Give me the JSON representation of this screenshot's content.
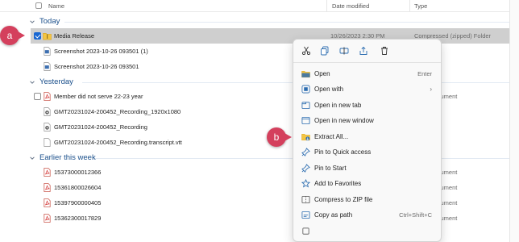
{
  "header": {
    "name": "Name",
    "date_modified": "Date modified",
    "type": "Type"
  },
  "groups": [
    {
      "label": "Today"
    },
    {
      "label": "Yesterday"
    },
    {
      "label": "Earlier this week"
    }
  ],
  "files": {
    "today": [
      {
        "name": "Media Release",
        "date": "10/26/2023 2:30 PM",
        "type": "Compressed (zipped) Folder",
        "icon": "zip-folder-icon",
        "selected": true
      },
      {
        "name": "Screenshot 2023-10-26 093501 (1)",
        "date": "",
        "type": "",
        "icon": "image-file-icon"
      },
      {
        "name": "Screenshot 2023-10-26 093501",
        "date": "",
        "type": "",
        "icon": "image-file-icon"
      }
    ],
    "yesterday": [
      {
        "name": "Member did not serve 22-23 year",
        "date": "",
        "type": "robat Document",
        "icon": "pdf-icon"
      },
      {
        "name": "GMT20231024-200452_Recording_1920x1080",
        "date": "",
        "type": "",
        "icon": "video-file-icon"
      },
      {
        "name": "GMT20231024-200452_Recording",
        "date": "",
        "type": "",
        "icon": "video-file-icon"
      },
      {
        "name": "GMT20231024-200452_Recording.transcript.vtt",
        "date": "",
        "type": "",
        "icon": "text-file-icon"
      }
    ],
    "earlier": [
      {
        "name": "15373000012366",
        "date": "",
        "type": "robat Document",
        "icon": "pdf-icon"
      },
      {
        "name": "15361800026604",
        "date": "",
        "type": "robat Document",
        "icon": "pdf-icon"
      },
      {
        "name": "15397900000405",
        "date": "",
        "type": "robat Document",
        "icon": "pdf-icon"
      },
      {
        "name": "15362300017829",
        "date": "",
        "type": "robat Document",
        "icon": "pdf-icon"
      }
    ]
  },
  "badges": {
    "a": "a",
    "b": "b"
  },
  "context_menu": {
    "toolbar": [
      "cut-icon",
      "copy-icon",
      "rename-icon",
      "share-icon",
      "delete-icon"
    ],
    "items": [
      {
        "label": "Open",
        "shortcut": "Enter",
        "icon": "open-folder-icon"
      },
      {
        "label": "Open with",
        "shortcut": "",
        "icon": "open-with-icon",
        "submenu": true
      },
      {
        "label": "Open in new tab",
        "shortcut": "",
        "icon": "new-tab-icon"
      },
      {
        "label": "Open in new window",
        "shortcut": "",
        "icon": "new-window-icon"
      },
      {
        "label": "Extract All...",
        "shortcut": "",
        "icon": "extract-icon"
      },
      {
        "label": "Pin to Quick access",
        "shortcut": "",
        "icon": "pin-icon"
      },
      {
        "label": "Pin to Start",
        "shortcut": "",
        "icon": "pin-start-icon"
      },
      {
        "label": "Add to Favorites",
        "shortcut": "",
        "icon": "star-icon"
      },
      {
        "label": "Compress to ZIP file",
        "shortcut": "",
        "icon": "zip-icon"
      },
      {
        "label": "Copy as path",
        "shortcut": "Ctrl+Shift+C",
        "icon": "copy-path-icon"
      }
    ]
  },
  "colors": {
    "accent": "#1967d2",
    "badge": "#d4405d",
    "group_text": "#1a4f8b",
    "selected_row": "#cfcfcf"
  }
}
